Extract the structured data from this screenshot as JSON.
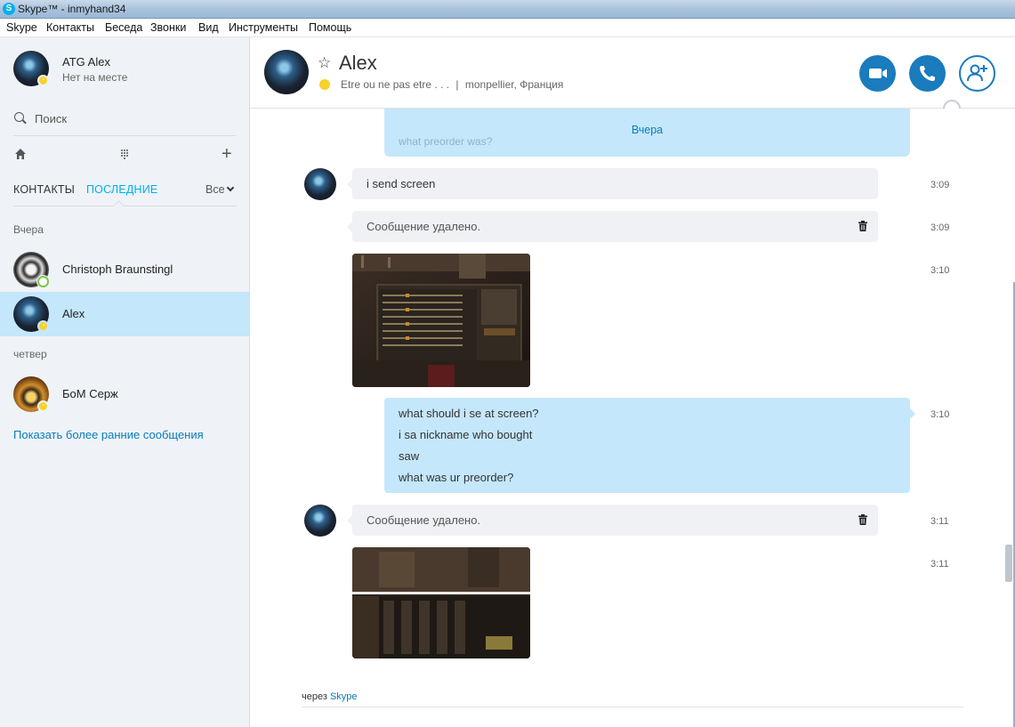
{
  "window": {
    "title": "Skype™ - inmyhand34"
  },
  "menu": [
    "Skype",
    "Контакты",
    "Беседа",
    "Звонки",
    "Вид",
    "Инструменты",
    "Помощь"
  ],
  "profile": {
    "name": "ATG Alex",
    "status": "Нет на месте"
  },
  "search": {
    "placeholder": "Поиск"
  },
  "tabs": {
    "contacts": "КОНТАКТЫ",
    "recent": "ПОСЛЕДНИЕ",
    "filter": "Все"
  },
  "recent_groups": [
    {
      "label": "Вчера",
      "contacts": [
        {
          "name": "Christoph Braunstingl",
          "status": "offline"
        },
        {
          "name": "Alex",
          "status": "away",
          "selected": true
        }
      ]
    },
    {
      "label": "четвер",
      "contacts": [
        {
          "name": "БоМ Серж",
          "status": "away"
        }
      ]
    }
  ],
  "show_earlier": "Показать более ранние сообщения",
  "conversation": {
    "name": "Alex",
    "mood": "Etre ou ne pas etre . . .",
    "separator": "|",
    "location": "monpellier, Франция",
    "buttons": [
      "video-call",
      "audio-call",
      "add-people"
    ]
  },
  "messages": {
    "date_banner": "Вчера",
    "ghost_text": "what preorder was?",
    "items": [
      {
        "type": "text",
        "from": "Alex",
        "text": "i send screen",
        "time": "3:09"
      },
      {
        "type": "deleted",
        "from": "Alex",
        "text": "Сообщение удалено.",
        "time": "3:09"
      },
      {
        "type": "image",
        "from": "Alex",
        "time": "3:10"
      },
      {
        "type": "text",
        "from": "me",
        "lines": [
          "what should i se at screen?",
          "i sa nickname who bought",
          "saw",
          "what was ur preorder?"
        ],
        "time": "3:10"
      },
      {
        "type": "deleted",
        "from": "Alex",
        "text": "Сообщение удалено.",
        "time": "3:11"
      },
      {
        "type": "image",
        "from": "Alex",
        "time": "3:11"
      }
    ]
  },
  "footer": {
    "via": "через",
    "via_link": "Skype"
  },
  "colors": {
    "accent": "#00aff0",
    "button": "#1a7bbd",
    "incoming": "#eff1f4",
    "outgoing": "#c5e7fb",
    "away": "#f8d22a",
    "sidebar": "#eff3f7"
  }
}
